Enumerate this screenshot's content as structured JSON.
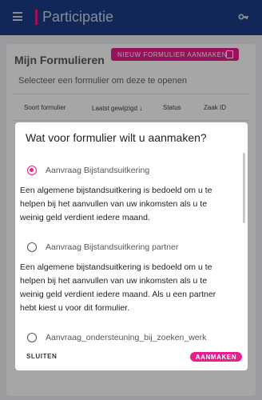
{
  "app": {
    "title": "Participatie"
  },
  "page": {
    "title": "Mijn Formulieren",
    "new_form_button": "NIEUW FORMULIER AANMAKEN",
    "select_hint": "Selecteer een formulier om deze te openen",
    "table": {
      "columns": [
        "Soort formulier",
        "Laatst gewijzigd",
        "Status",
        "Zaak ID"
      ],
      "sort_indicator": "↓"
    }
  },
  "dialog": {
    "title": "Wat voor formulier wilt u aanmaken?",
    "options": [
      {
        "label": "Aanvraag Bijstandsuitkering",
        "checked": true,
        "description": [
          "Een algemene bijstandsuitkering is bedoeld om u te",
          "helpen bij het aanvullen van uw inkomsten als u te",
          "weinig geld verdient iedere maand."
        ]
      },
      {
        "label": "Aanvraag Bijstandsuitkering partner",
        "checked": false,
        "description": [
          "Een algemene bijstandsuitkering is bedoeld om u te",
          "helpen bij het aanvullen van uw inkomsten als u te",
          "weinig geld verdient iedere maand. Als u een partner",
          "hebt kiest u voor dit formulier."
        ]
      },
      {
        "label": "Aanvraag_ondersteuning_bij_zoeken_werk",
        "checked": false
      }
    ],
    "close_label": "SLUITEN",
    "create_label": "AANMAKEN"
  },
  "colors": {
    "appbar": "#1b3d86",
    "accent": "#e91e8c"
  },
  "icons": {
    "menu": "hamburger-icon",
    "key": "key-icon",
    "form": "form-icon"
  }
}
